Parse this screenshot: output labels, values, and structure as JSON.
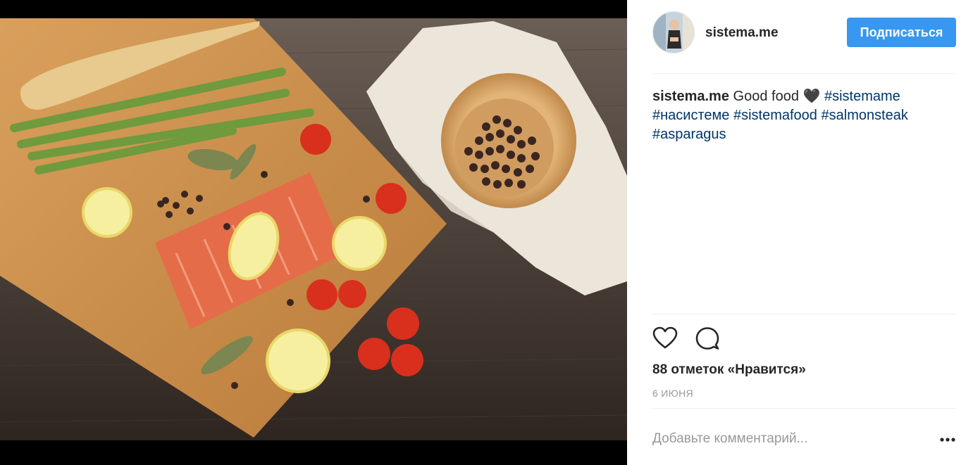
{
  "post": {
    "username": "sistema.me",
    "follow_label": "Подписаться",
    "caption": {
      "username": "sistema.me",
      "text": "Good food 🖤",
      "hashtags": [
        "#sistemame",
        "#насистеме",
        "#sistemafood",
        "#salmonsteak",
        "#asparagus"
      ]
    },
    "likes": "88 отметок «Нравится»",
    "date": "6 ИЮНЯ",
    "comment_placeholder": "Добавьте комментарий..."
  },
  "icons": {
    "like": "heart-icon",
    "comment": "comment-icon",
    "more": "more-options-icon",
    "avatar": "avatar"
  },
  "colors": {
    "follow_button": "#3897f0",
    "hashtag": "#003569",
    "text": "#262626",
    "muted": "#999999"
  }
}
